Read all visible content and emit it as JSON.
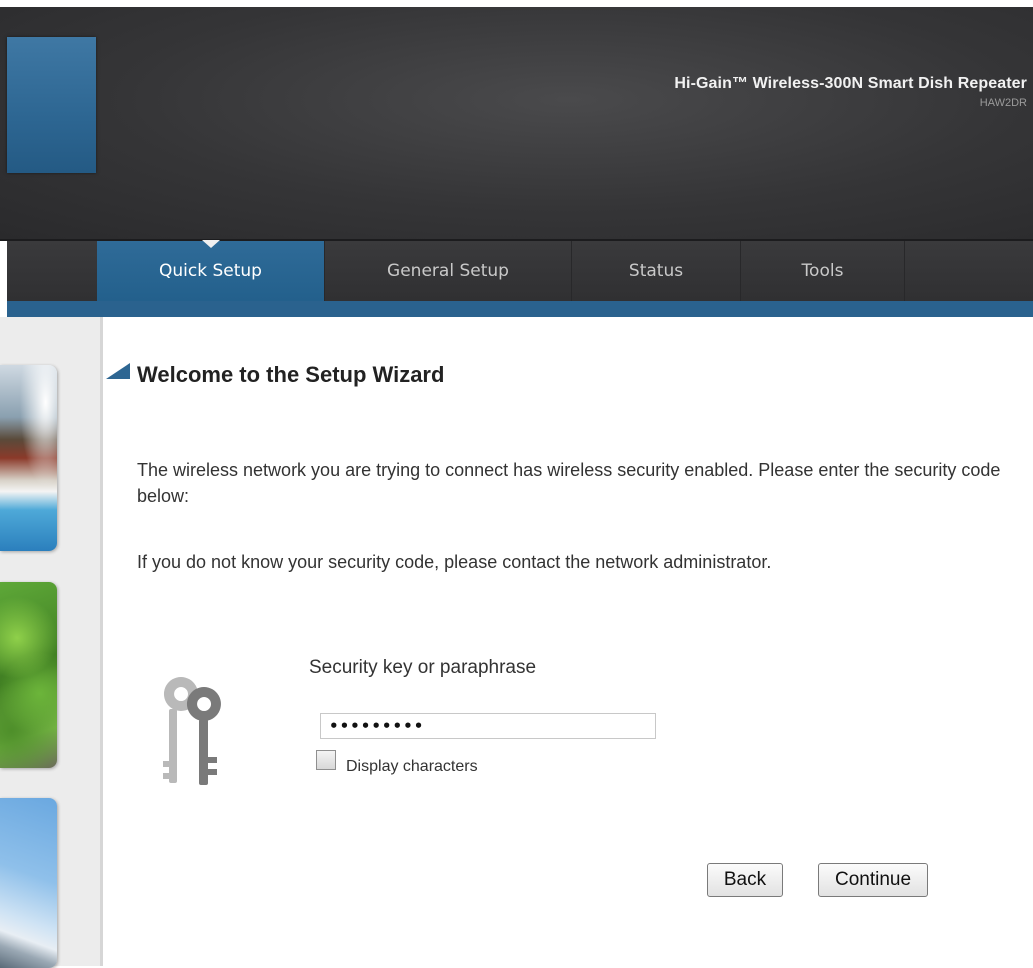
{
  "header": {
    "product_title": "Hi-Gain™ Wireless-300N Smart Dish Repeater",
    "model": "HAW2DR"
  },
  "nav": {
    "tabs": [
      {
        "label": "Quick Setup",
        "active": true
      },
      {
        "label": "General Setup",
        "active": false
      },
      {
        "label": "Status",
        "active": false
      },
      {
        "label": "Tools",
        "active": false
      }
    ]
  },
  "main": {
    "title": "Welcome to the Setup Wizard",
    "paragraph1": "The wireless network you are trying to connect has wireless security enabled. Please enter the security code below:",
    "paragraph2": "If you do not know your security code, please contact the network administrator.",
    "key_label": "Security key or paraphrase",
    "key_value": "•••••••••",
    "display_characters_label": "Display characters",
    "display_characters_checked": false,
    "back_label": "Back",
    "continue_label": "Continue"
  },
  "colors": {
    "accent": "#2a628e",
    "header_bg": "#353537",
    "navbar_bg": "#333335"
  },
  "icons": {
    "keys": "keys-icon",
    "heading_marker": "triangle-marker-icon"
  }
}
